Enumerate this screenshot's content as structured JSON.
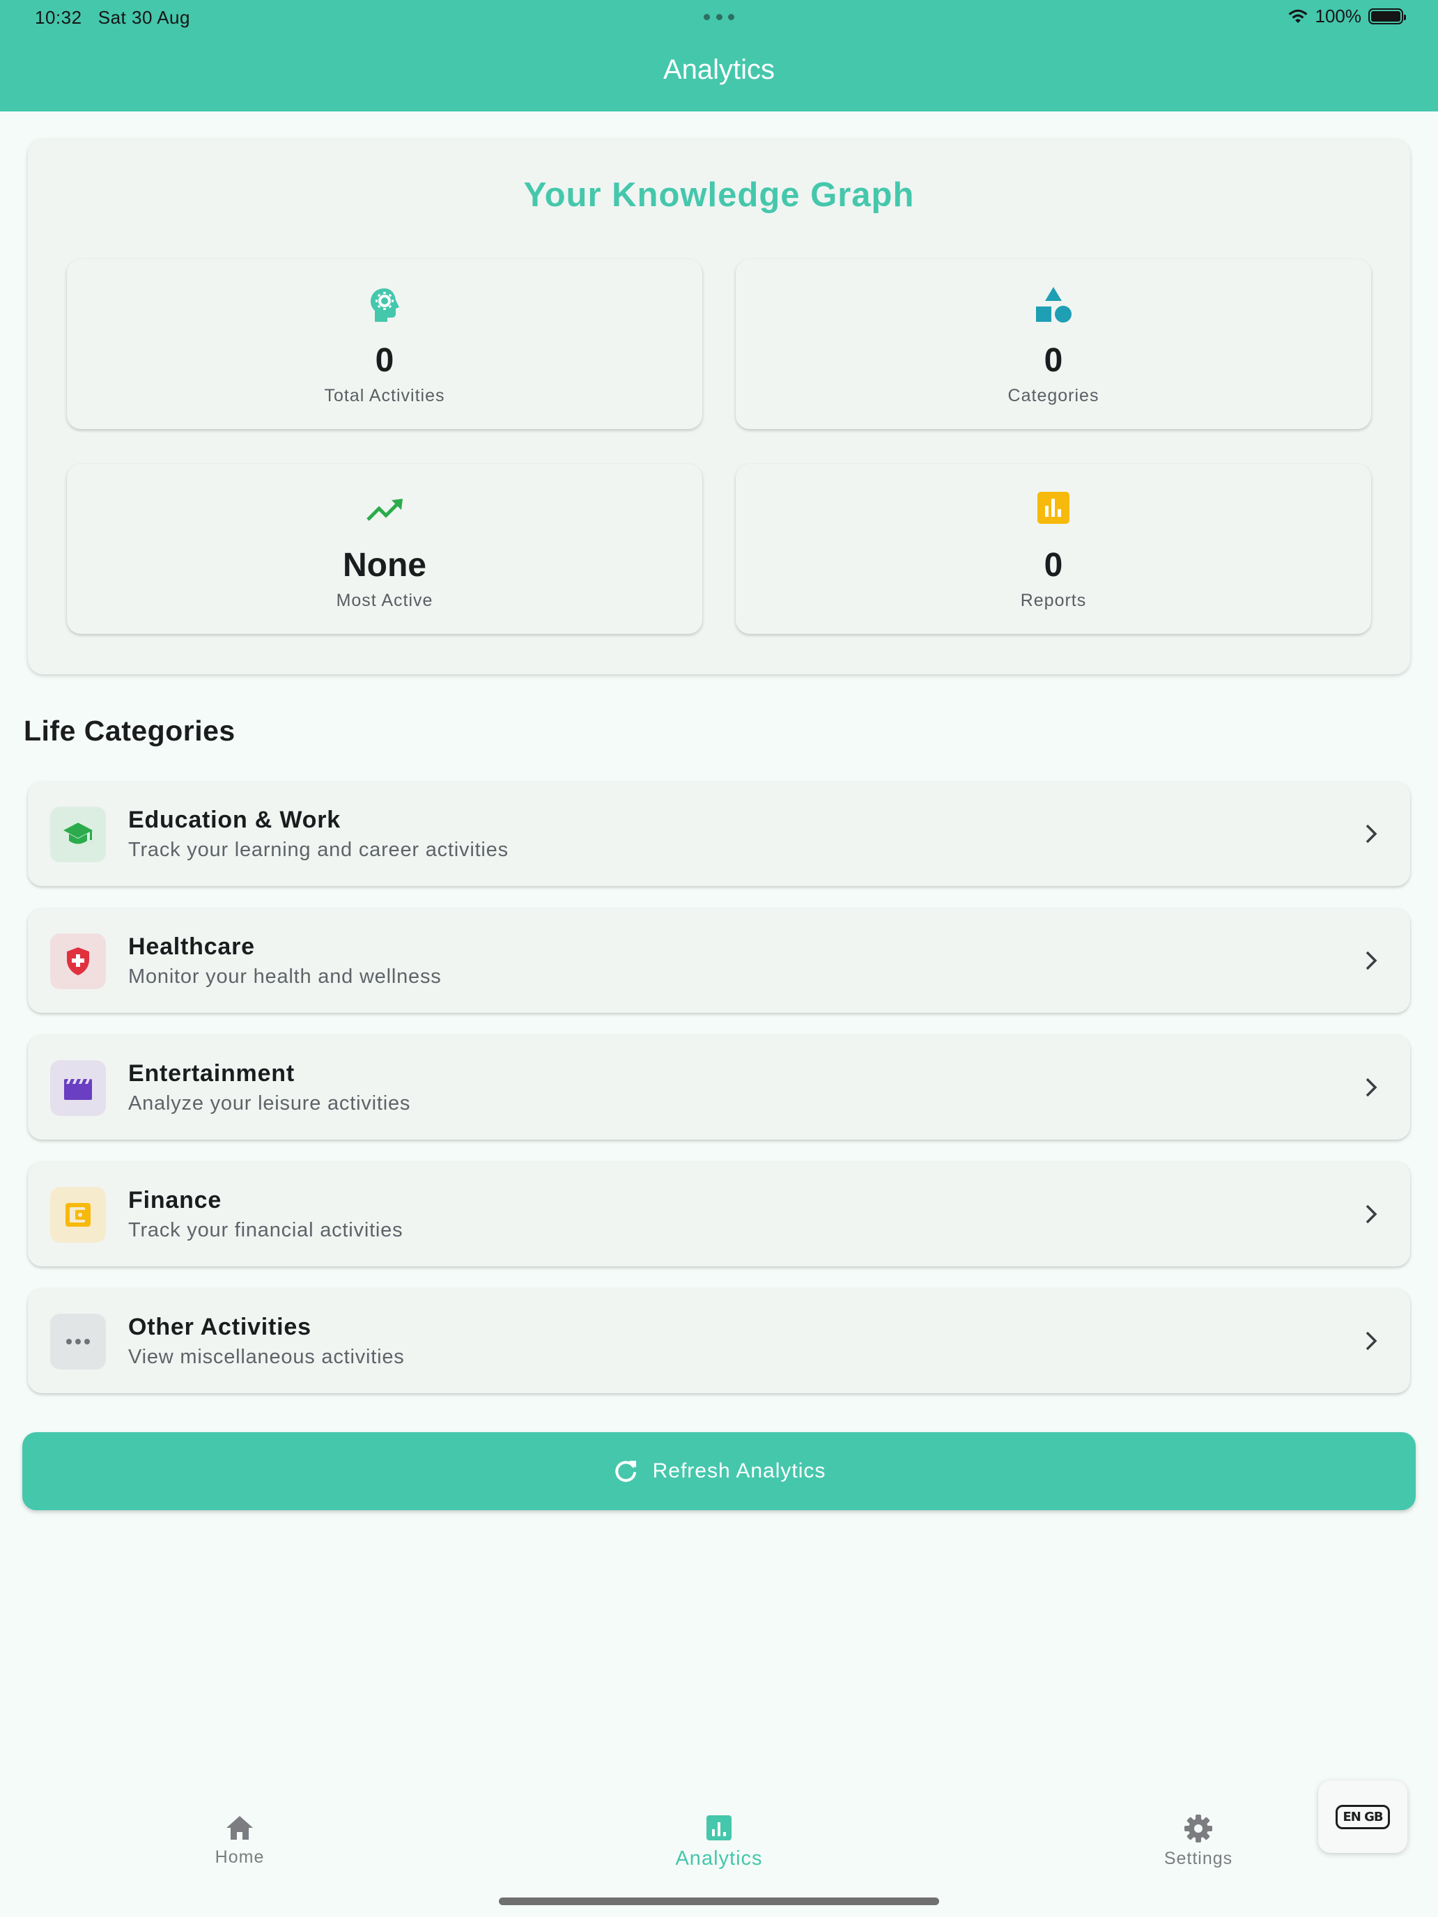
{
  "status_bar": {
    "time": "10:32",
    "date": "Sat 30 Aug",
    "battery": "100%"
  },
  "header": {
    "title": "Analytics"
  },
  "knowledge_graph": {
    "title": "Your Knowledge Graph",
    "stats": [
      {
        "value": "0",
        "label": "Total Activities",
        "icon": "psychology-icon",
        "color": "#45c7ac"
      },
      {
        "value": "0",
        "label": "Categories",
        "icon": "category-shapes-icon",
        "color": "#1e9fb4"
      },
      {
        "value": "None",
        "label": "Most Active",
        "icon": "trending-up-icon",
        "color": "#2bab4b"
      },
      {
        "value": "0",
        "label": "Reports",
        "icon": "bar-chart-icon",
        "color": "#f7b90b"
      }
    ]
  },
  "life_categories": {
    "heading": "Life Categories",
    "items": [
      {
        "title": "Education & Work",
        "subtitle": "Track your learning and career activities",
        "icon": "graduation-cap-icon",
        "color": "#2bab4b",
        "bg": "#dceee2"
      },
      {
        "title": "Healthcare",
        "subtitle": "Monitor your health and wellness",
        "icon": "health-shield-icon",
        "color": "#e0313f",
        "bg": "#f1dfe0"
      },
      {
        "title": "Entertainment",
        "subtitle": "Analyze your leisure activities",
        "icon": "clapperboard-icon",
        "color": "#6a3fc2",
        "bg": "#e4e0ee"
      },
      {
        "title": "Finance",
        "subtitle": "Track your financial activities",
        "icon": "wallet-icon",
        "color": "#f7b90b",
        "bg": "#f6ebcd"
      },
      {
        "title": "Other Activities",
        "subtitle": "View miscellaneous activities",
        "icon": "more-horizontal-icon",
        "color": "#6f7276",
        "bg": "#e2e5e5"
      }
    ]
  },
  "refresh_button": {
    "label": "Refresh Analytics"
  },
  "bottom_nav": {
    "items": [
      {
        "label": "Home",
        "icon": "home-icon",
        "active": false
      },
      {
        "label": "Analytics",
        "icon": "analytics-icon",
        "active": true
      },
      {
        "label": "Settings",
        "icon": "gear-icon",
        "active": false
      }
    ]
  },
  "language_button": {
    "label": "EN GB"
  },
  "colors": {
    "accent": "#45c7ac",
    "background": "#f5fbf8",
    "card": "#f0f5f2"
  }
}
